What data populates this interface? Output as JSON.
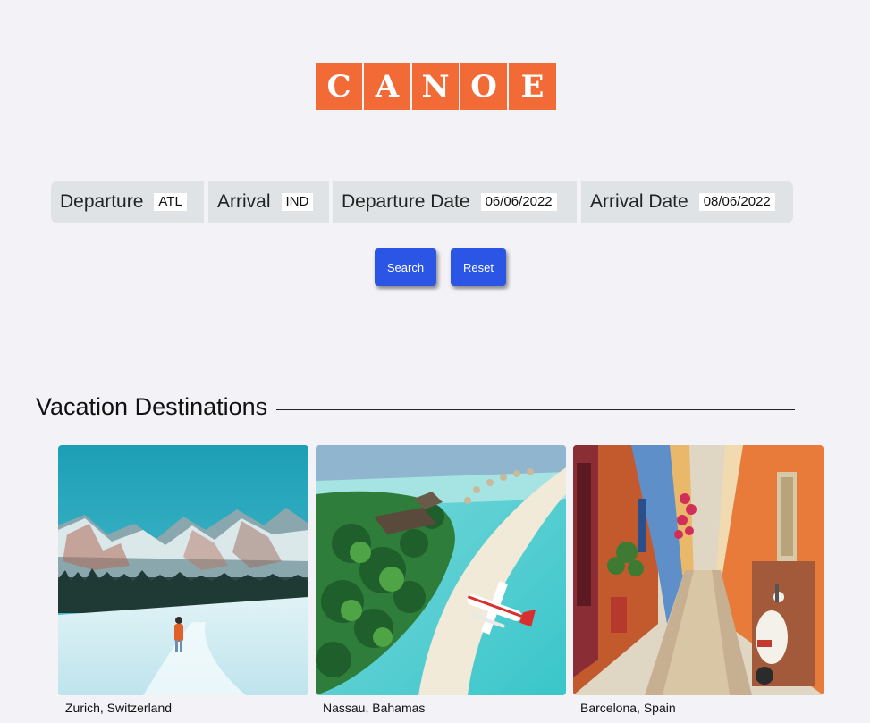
{
  "logo": {
    "letters": [
      "C",
      "A",
      "N",
      "O",
      "E"
    ],
    "color": "#f26b36"
  },
  "search": {
    "departure": {
      "label": "Departure",
      "value": "ATL"
    },
    "arrival": {
      "label": "Arrival",
      "value": "IND"
    },
    "departure_date": {
      "label": "Departure Date",
      "value": "06/06/2022"
    },
    "arrival_date": {
      "label": "Arrival Date",
      "value": "08/06/2022"
    },
    "search_label": "Search",
    "reset_label": "Reset",
    "button_color": "#2a55e5"
  },
  "destinations": {
    "title": "Vacation Destinations",
    "items": [
      {
        "caption": "Zurich, Switzerland",
        "image": "snowy-mountain-photo"
      },
      {
        "caption": "Nassau, Bahamas",
        "image": "tropical-island-seaplane-photo"
      },
      {
        "caption": "Barcelona, Spain",
        "image": "colorful-alley-scooter-photo"
      }
    ]
  }
}
